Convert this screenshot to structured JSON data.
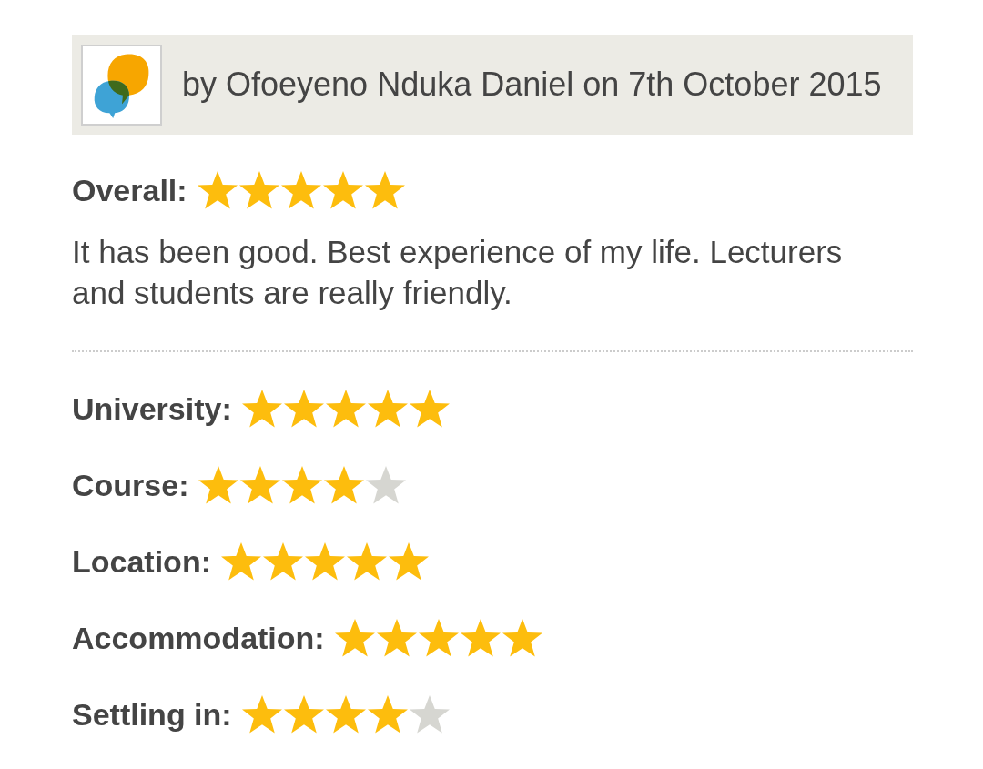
{
  "review": {
    "author_line": "by Ofoeyeno Nduka Daniel on 7th October 2015",
    "overall": {
      "label": "Overall:",
      "stars": 5
    },
    "comment": "It has been good. Best experience of my life. Lecturers and students are really friendly.",
    "ratings": [
      {
        "label": "University:",
        "stars": 5
      },
      {
        "label": "Course:",
        "stars": 4
      },
      {
        "label": "Location:",
        "stars": 5
      },
      {
        "label": "Accommodation:",
        "stars": 5
      },
      {
        "label": "Settling in:",
        "stars": 4
      }
    ]
  }
}
